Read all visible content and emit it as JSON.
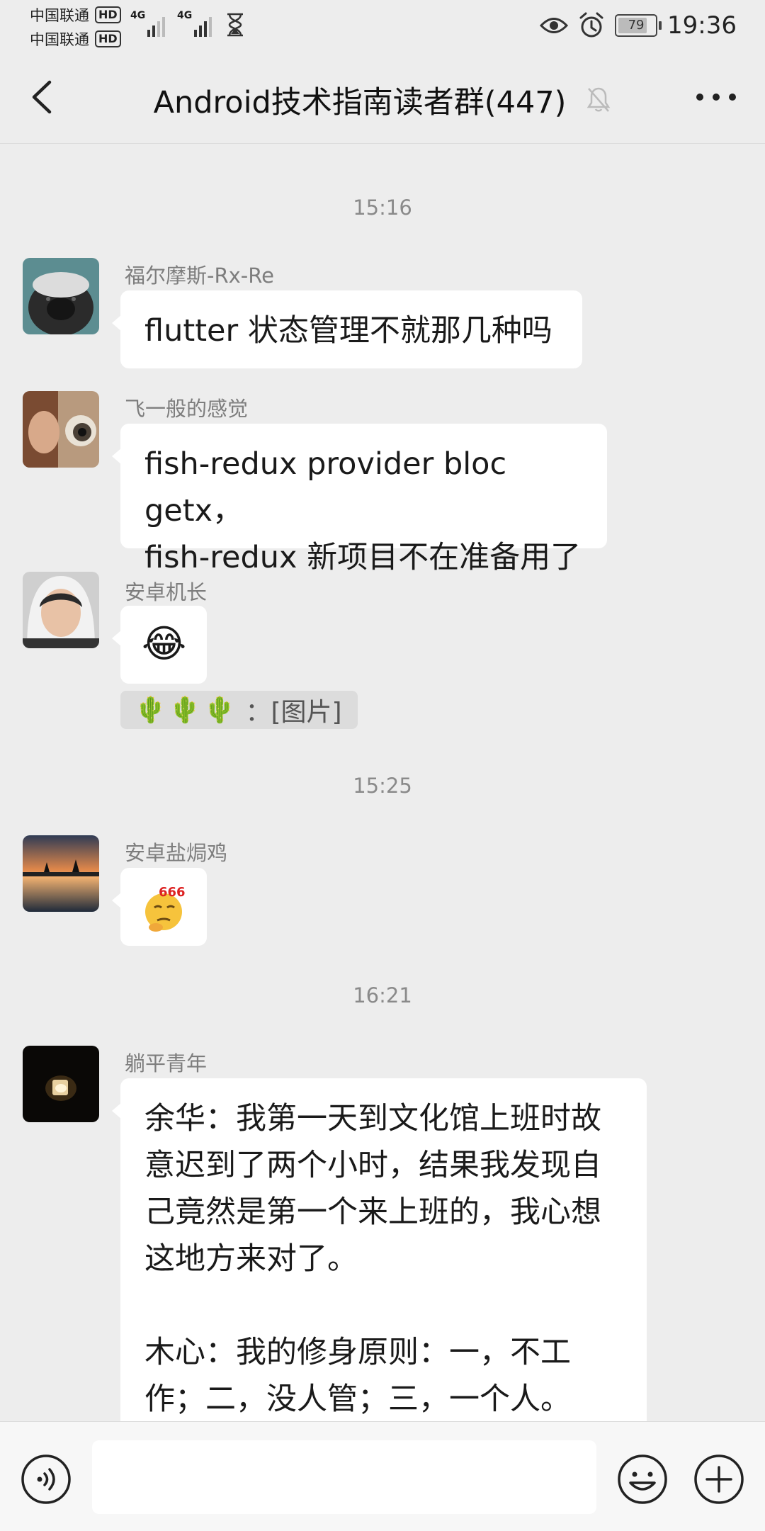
{
  "status_bar": {
    "carrier1": "中国联通",
    "carrier2": "中国联通",
    "hd_badge": "HD",
    "network1": "4G",
    "network2": "4G",
    "battery": "79",
    "battery_level": 0.79,
    "time": "19:36"
  },
  "header": {
    "title": "Android技术指南读者群(447)",
    "back_icon": "chevron-left-icon",
    "mute_icon": "bell-muted-icon",
    "more_icon": "more-dots-icon"
  },
  "messages": [
    {
      "time": "15:16"
    },
    {
      "sender": "福尔摩斯-Rx-Re",
      "text": "flutter 状态管理不就那几种吗"
    },
    {
      "sender": "飞一般的感觉",
      "text": "fish-redux provider bloc getx，\nfish-redux 新项目不在准备用了"
    },
    {
      "sender": "安卓机长",
      "emoji": "😂",
      "quote_emojis": "🌵🌵🌵",
      "quote_text": "：[图片]"
    },
    {
      "time": "15:25"
    },
    {
      "sender": "安卓盐焗鸡",
      "sticker_label": "666"
    },
    {
      "time": "16:21"
    },
    {
      "sender": "躺平青年",
      "text": "余华：我第一天到文化馆上班时故\n意迟到了两个小时，结果我发现自\n己竟然是第一个来上班的，我心想\n这地方来对了。\n\n木心：我的修身原则：一，不工\n作；二，没人管；三，一个人。"
    }
  ],
  "input_bar": {
    "placeholder": "",
    "voice_icon": "voice-icon",
    "emoji_icon": "smiley-icon",
    "plus_icon": "plus-circle-icon"
  },
  "colors": {
    "background": "#ededed",
    "bubble": "#ffffff",
    "time_text": "#8a8a8a",
    "sender_text": "#7d7d7d"
  }
}
